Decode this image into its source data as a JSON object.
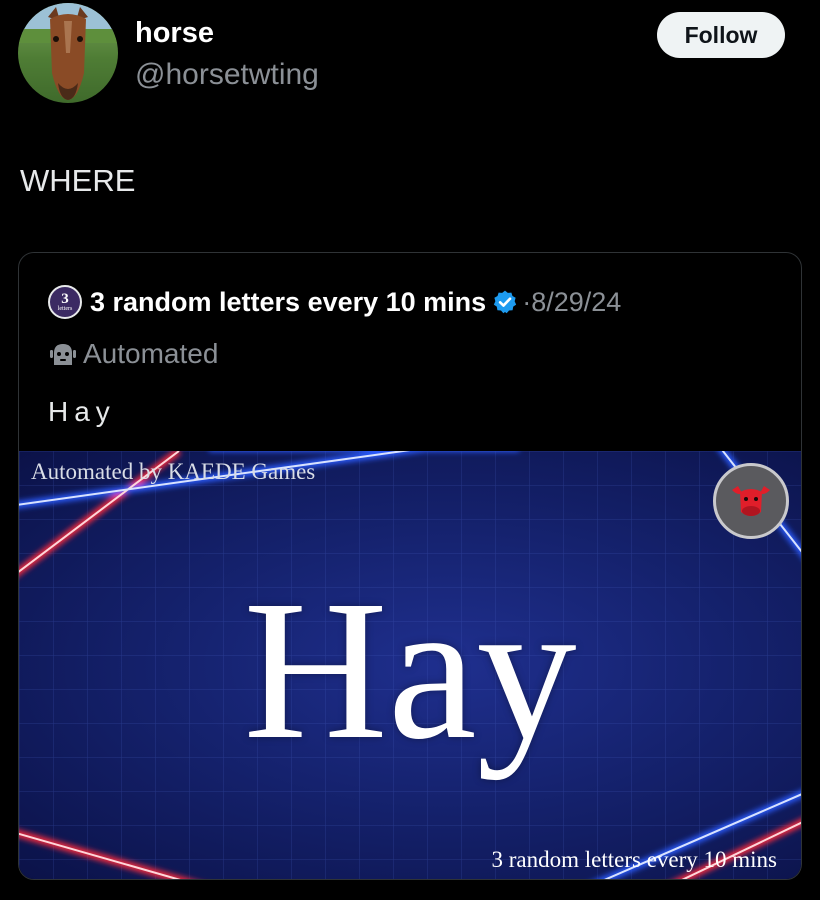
{
  "author": {
    "display_name": "horse",
    "handle": "@horsetwting",
    "follow_label": "Follow"
  },
  "tweet": {
    "text": "WHERE"
  },
  "quote": {
    "avatar_text_big": "3",
    "avatar_text_small": "letters",
    "name": "3 random letters every 10 mins",
    "date": "·8/29/24",
    "automated_label": "Automated",
    "text": "Hay",
    "media": {
      "top_caption": "Automated by KAEDE Games",
      "word": "Hay",
      "bottom_caption": "3 random letters every 10 mins"
    }
  },
  "colors": {
    "background": "#000000",
    "verified_blue": "#1d9bf0",
    "muted_text": "#8b9096",
    "media_bg": "#15226e"
  },
  "icons": {
    "verified": "verified-badge-icon",
    "automated": "bot-icon",
    "media_logo": "cow-icon"
  }
}
